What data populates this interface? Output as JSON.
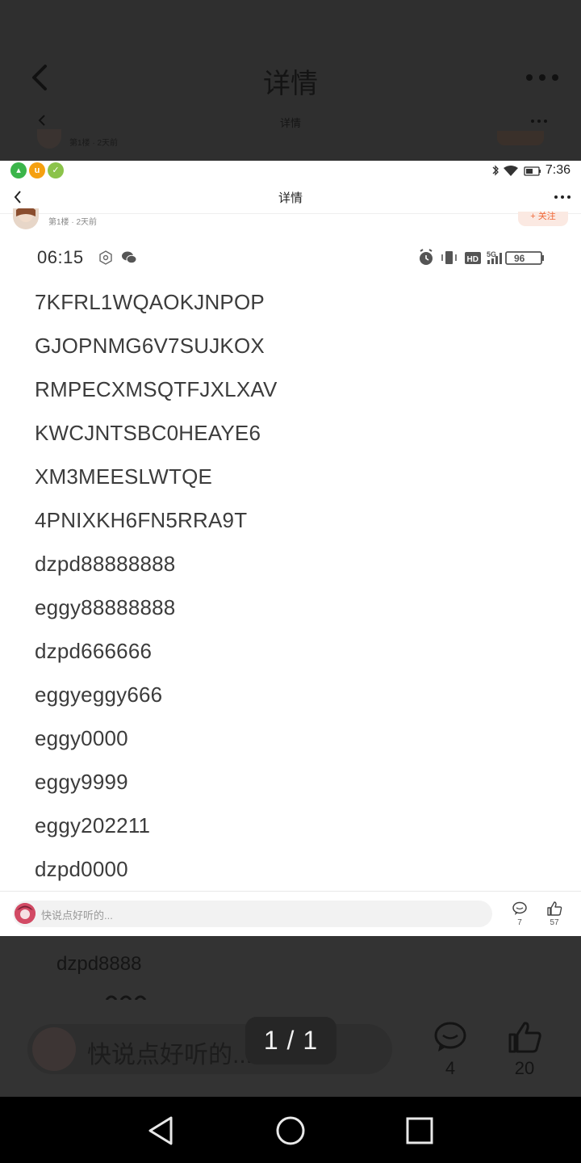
{
  "viewer": {
    "title": "详情",
    "sub_title": "详情",
    "sub_meta": "第1楼 · 2天前",
    "bg_item": "dzpd8888",
    "input_placeholder": "快说点好听的...",
    "comment_count": "4",
    "like_count": "20",
    "page_indicator": "1 / 1"
  },
  "screenshot": {
    "status_bar": {
      "time": "7:36",
      "apps": [
        {
          "icon": "android-store-icon",
          "glyph": "▴",
          "color": "#3bb54a"
        },
        {
          "icon": "uc-browser-icon",
          "glyph": "u",
          "color": "#f5a010"
        },
        {
          "icon": "leaf-app-icon",
          "glyph": "✓",
          "color": "#8bc34a"
        }
      ]
    },
    "nav": {
      "title": "详情"
    },
    "post": {
      "meta": "第1楼 · 2天前",
      "follow": "+ 关注"
    },
    "image": {
      "time": "06:15",
      "battery": "96",
      "codes": [
        "7KFRL1WQAOKJNPOP",
        "GJOPNMG6V7SUJKOX",
        "RMPECXMSQTFJXLXAV",
        "KWCJNTSBC0HEAYE6",
        "XM3MEESLWTQE",
        "4PNIXKH6FN5RRA9T",
        "dzpd88888888",
        "eggy88888888",
        "dzpd666666",
        "eggyeggy666",
        "eggy0000",
        "eggy9999",
        "eggy202211",
        "dzpd0000"
      ]
    },
    "bottom": {
      "placeholder": "快说点好听的...",
      "comment_count": "7",
      "like_count": "57"
    }
  }
}
